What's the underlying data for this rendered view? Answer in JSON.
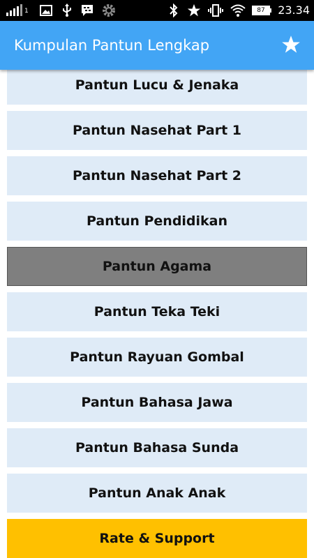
{
  "status_bar": {
    "time": "23.34",
    "battery": "87",
    "sim_label": "1",
    "icons": [
      "signal-icon",
      "image-icon",
      "usb-icon",
      "bbm-icon",
      "settings-icon",
      "bluetooth-icon",
      "star-icon",
      "vibrate-icon",
      "wifi-icon",
      "battery-icon"
    ]
  },
  "app_bar": {
    "title": "Kumpulan Pantun Lengkap",
    "action_icon": "star-icon"
  },
  "menu": {
    "items": [
      {
        "label": "Pantun Lucu & Jenaka",
        "state": "normal"
      },
      {
        "label": "Pantun Nasehat Part 1",
        "state": "normal"
      },
      {
        "label": "Pantun Nasehat Part 2",
        "state": "normal"
      },
      {
        "label": "Pantun Pendidikan",
        "state": "normal"
      },
      {
        "label": "Pantun Agama",
        "state": "pressed"
      },
      {
        "label": "Pantun Teka Teki",
        "state": "normal"
      },
      {
        "label": "Pantun Rayuan Gombal",
        "state": "normal"
      },
      {
        "label": "Pantun Bahasa Jawa",
        "state": "normal"
      },
      {
        "label": "Pantun Bahasa Sunda",
        "state": "normal"
      },
      {
        "label": "Pantun Anak Anak",
        "state": "normal"
      }
    ],
    "rate_button": {
      "label": "Rate & Support"
    }
  },
  "colors": {
    "app_bar": "#42a5f5",
    "item_bg": "#dfebf7",
    "pressed_bg": "#7f7f7f",
    "rate_bg": "#ffc000"
  }
}
